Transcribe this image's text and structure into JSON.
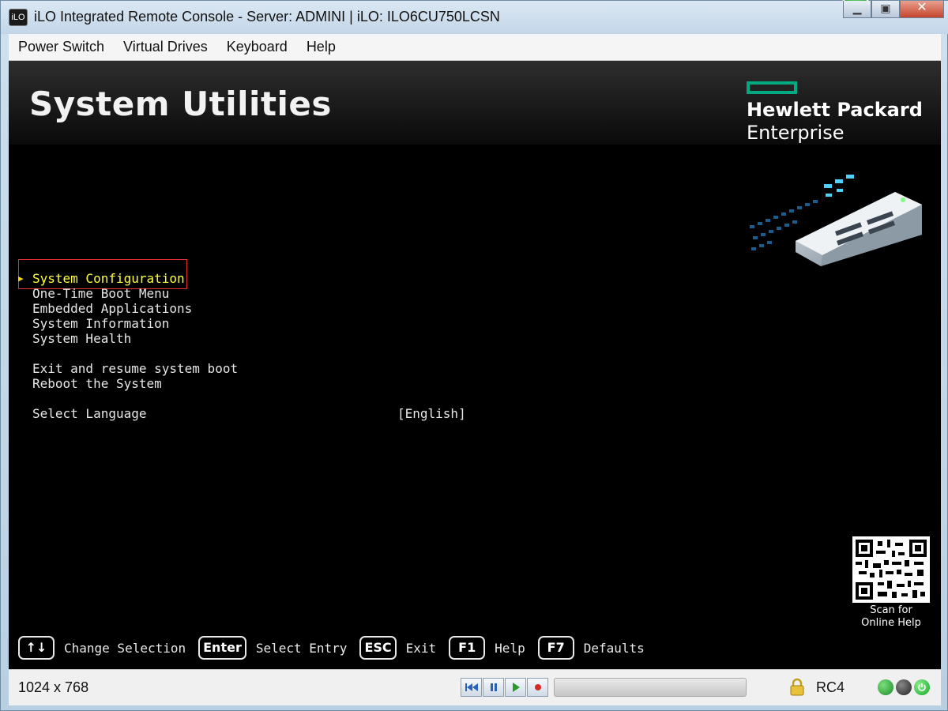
{
  "window": {
    "app_icon_text": "iLO",
    "title": "iLO Integrated Remote Console - Server: ADMINI | iLO: ILO6CU750LCSN",
    "minimize_glyph": "▁",
    "maximize_glyph": "▣",
    "close_glyph": "✕"
  },
  "menubar": {
    "items": [
      {
        "label": "Power Switch"
      },
      {
        "label": "Virtual Drives"
      },
      {
        "label": "Keyboard"
      },
      {
        "label": "Help"
      }
    ]
  },
  "console": {
    "page_title": "System Utilities",
    "brand": {
      "line1": "Hewlett Packard",
      "line2": "Enterprise",
      "accent_color": "#01a982"
    },
    "menu": {
      "selected_arrow": "▶",
      "items": [
        {
          "label": "System Configuration",
          "selected": true
        },
        {
          "label": "One-Time Boot Menu"
        },
        {
          "label": "Embedded Applications"
        },
        {
          "label": "System Information"
        },
        {
          "label": "System Health"
        },
        {
          "label": "Exit and resume system boot"
        },
        {
          "label": "Reboot the System"
        },
        {
          "label": "Select Language",
          "value": "[English]"
        }
      ]
    },
    "qr_caption": {
      "line1": "Scan for",
      "line2": "Online Help"
    },
    "keys": [
      {
        "key": "↑↓",
        "label": "Change Selection"
      },
      {
        "key": "Enter",
        "label": "Select Entry"
      },
      {
        "key": "ESC",
        "label": "Exit"
      },
      {
        "key": "F1",
        "label": "Help"
      },
      {
        "key": "F7",
        "label": "Defaults"
      }
    ]
  },
  "statusbar": {
    "resolution": "1024 x 768",
    "encryption": "RC4",
    "indicator_colors": [
      "#1a9a2a",
      "#3a3a3a",
      "#1fb52f"
    ]
  }
}
